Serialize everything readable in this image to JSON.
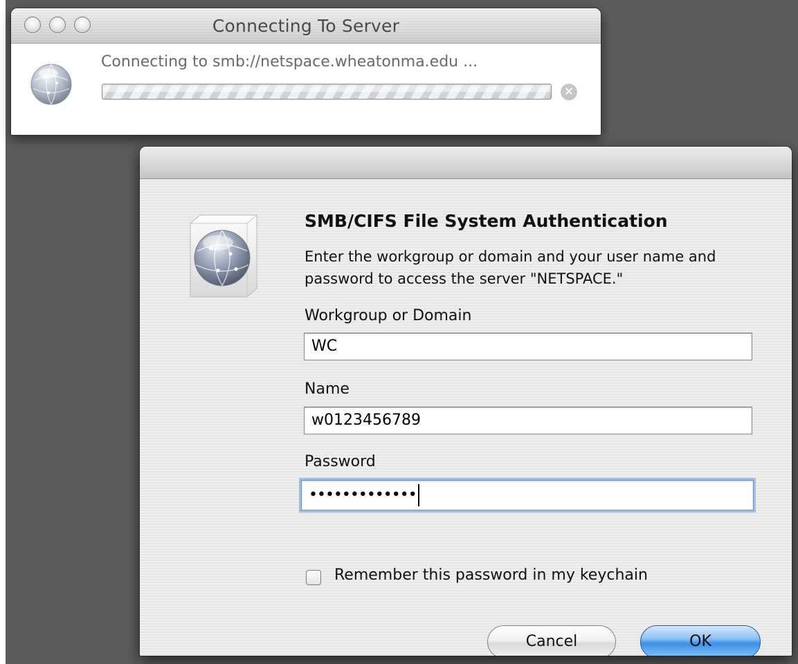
{
  "connecting_window": {
    "title": "Connecting To Server",
    "message": "Connecting to smb://netspace.wheatonma.edu ...",
    "icons": {
      "window_controls": [
        "close-icon",
        "minimize-icon",
        "zoom-icon"
      ],
      "server": "network-globe-icon",
      "stop": "stop-x-icon"
    }
  },
  "auth_dialog": {
    "heading": "SMB/CIFS File System Authentication",
    "description": "Enter the workgroup or domain and your user name and password to access the server \"NETSPACE.\"",
    "workgroup": {
      "label": "Workgroup or Domain",
      "value": "WC"
    },
    "name": {
      "label": "Name",
      "value": "w0123456789"
    },
    "password": {
      "label": "Password",
      "masked_value": "•••••••••••••"
    },
    "remember_checkbox": {
      "label": "Remember this password in my keychain",
      "checked": false
    },
    "buttons": {
      "cancel": "Cancel",
      "ok": "OK"
    },
    "icons": {
      "server": "network-globe-box-icon"
    }
  },
  "colors": {
    "desktop": "#5b5b5b",
    "focus_ring": "#9fbfe3",
    "default_button": "#3c8fe6"
  }
}
